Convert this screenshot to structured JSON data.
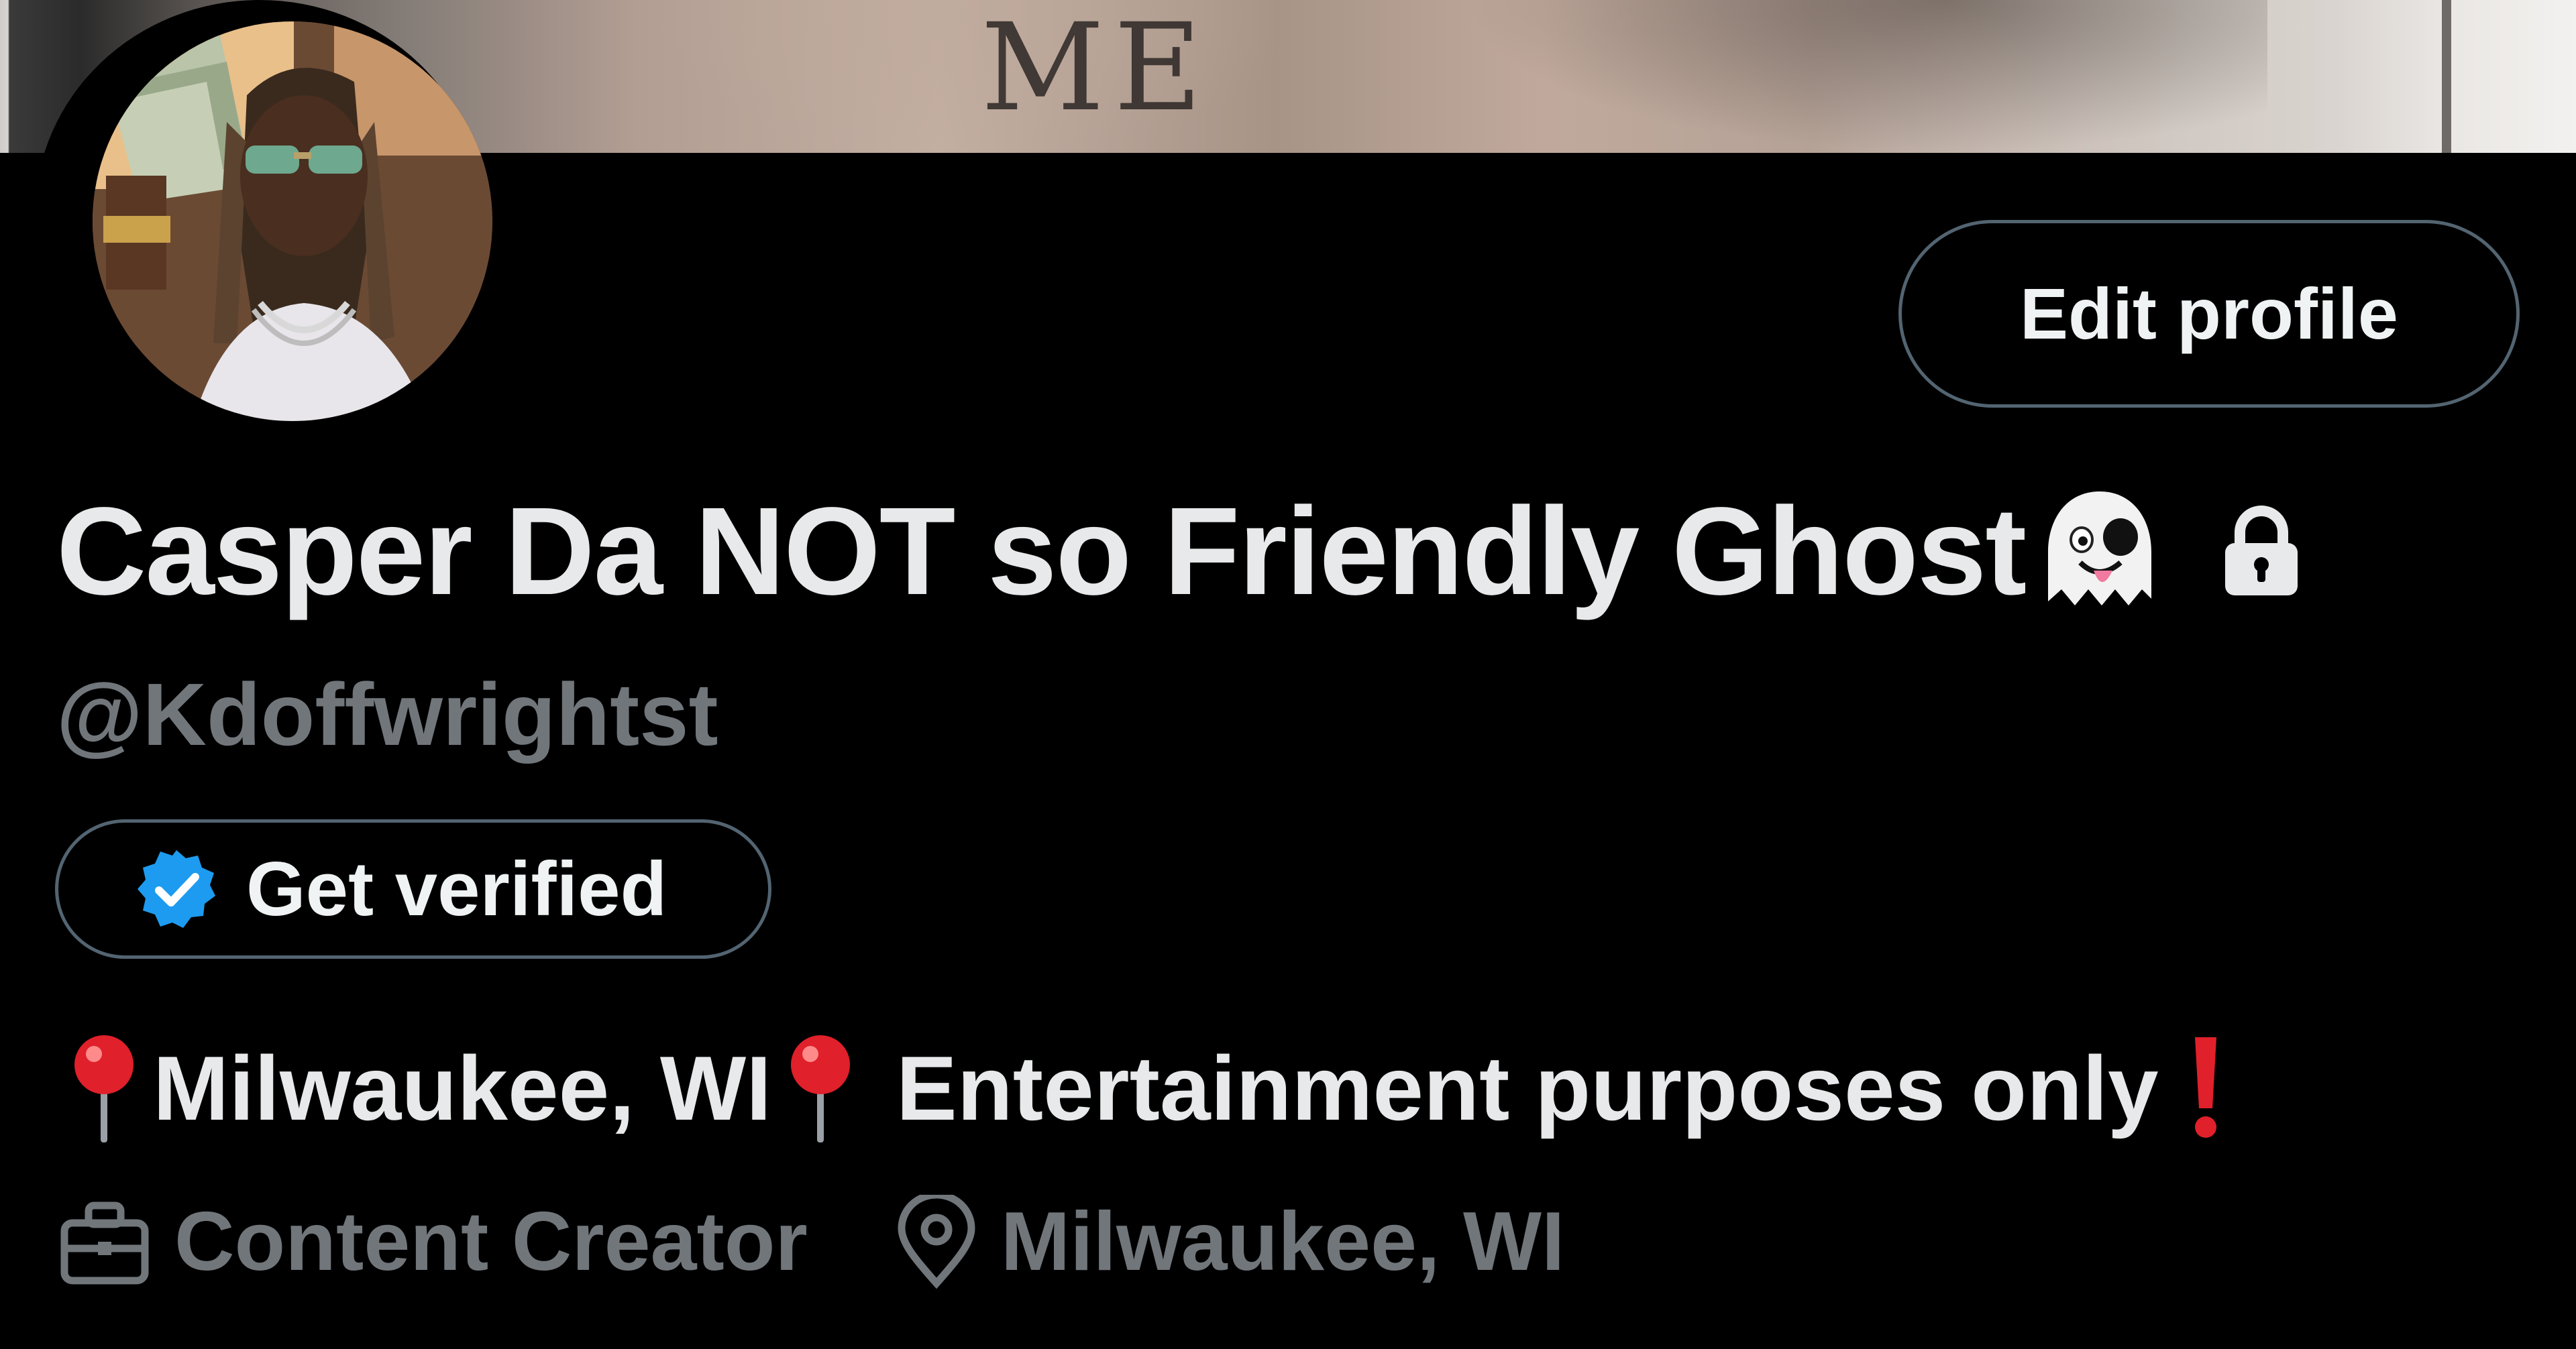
{
  "banner": {
    "tattoo_text": "ME"
  },
  "profile": {
    "display_name": "Casper Da NOT so Friendly Ghost",
    "name_emoji_icon": "ghost-emoji",
    "protected_icon": "lock-icon",
    "handle": "@Kdoffwrightst"
  },
  "actions": {
    "edit_profile_label": "Edit profile",
    "get_verified_label": "Get verified",
    "verified_icon": "verified-badge-icon"
  },
  "bio": {
    "segment_1": "Milwaukee, WI",
    "segment_2": "Entertainment purposes only",
    "leading_icon": "round-pushpin-emoji",
    "trailing_icon": "exclamation-mark-emoji"
  },
  "meta": {
    "category_icon": "briefcase-icon",
    "category": "Content Creator",
    "location_icon": "location-pin-icon",
    "location": "Milwaukee, WI"
  },
  "colors": {
    "background": "#000000",
    "primary_text": "#e7e9ea",
    "secondary_text": "#71767b",
    "border": "#536471",
    "verified_blue": "#1d9bf0",
    "alert_red": "#e0202a"
  }
}
